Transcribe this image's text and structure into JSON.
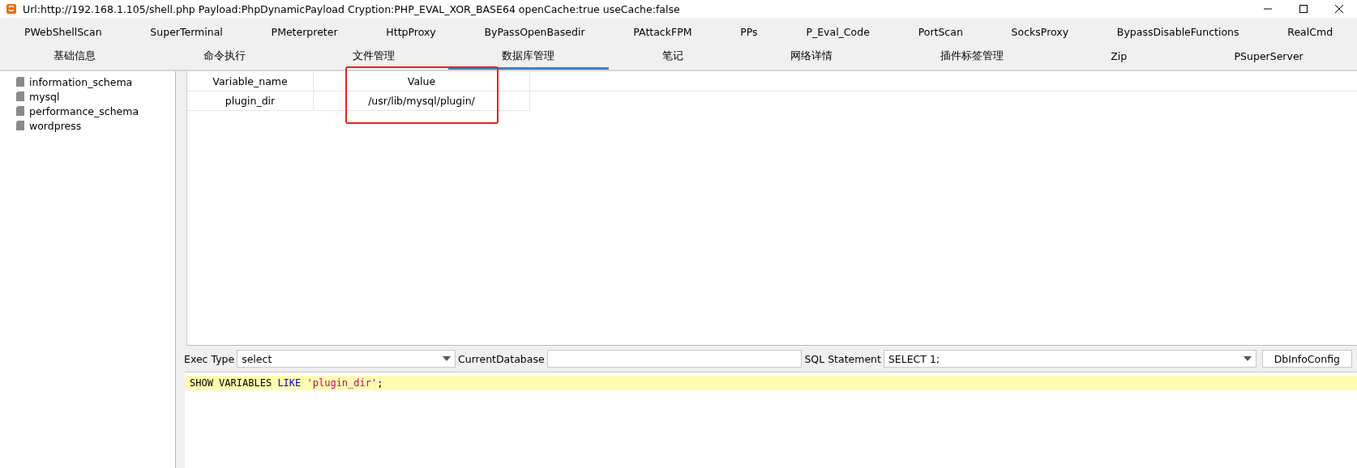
{
  "window": {
    "title": "Url:http://192.168.1.105/shell.php Payload:PhpDynamicPayload Cryption:PHP_EVAL_XOR_BASE64 openCache:true useCache:false"
  },
  "tab_rows": [
    [
      {
        "label": "PWebShellScan",
        "selected": false
      },
      {
        "label": "SuperTerminal",
        "selected": false
      },
      {
        "label": "PMeterpreter",
        "selected": false
      },
      {
        "label": "HttpProxy",
        "selected": false
      },
      {
        "label": "ByPassOpenBasedir",
        "selected": false
      },
      {
        "label": "PAttackFPM",
        "selected": false
      },
      {
        "label": "PPs",
        "selected": false
      },
      {
        "label": "P_Eval_Code",
        "selected": false
      },
      {
        "label": "PortScan",
        "selected": false
      },
      {
        "label": "SocksProxy",
        "selected": false
      },
      {
        "label": "BypassDisableFunctions",
        "selected": false
      },
      {
        "label": "RealCmd",
        "selected": false
      }
    ],
    [
      {
        "label": "基础信息",
        "selected": false
      },
      {
        "label": "命令执行",
        "selected": false
      },
      {
        "label": "文件管理",
        "selected": false
      },
      {
        "label": "数据库管理",
        "selected": true
      },
      {
        "label": "笔记",
        "selected": false
      },
      {
        "label": "网络详情",
        "selected": false
      },
      {
        "label": "插件标签管理",
        "selected": false
      },
      {
        "label": "Zip",
        "selected": false
      },
      {
        "label": "PSuperServer",
        "selected": false
      }
    ]
  ],
  "databases": [
    "information_schema",
    "mysql",
    "performance_schema",
    "wordpress"
  ],
  "table": {
    "columns": [
      "Variable_name",
      "Value"
    ],
    "rows": [
      [
        "plugin_dir",
        "/usr/lib/mysql/plugin/"
      ]
    ]
  },
  "toolbar": {
    "exec_type_label": "Exec Type",
    "exec_type": "select",
    "current_db_label": "CurrentDatabase",
    "sql_label": "SQL Statement",
    "sql": "SELECT 1;",
    "config_button": "DbInfoConfig"
  },
  "editor": {
    "tokens": [
      {
        "text": "SHOW VARIABLES ",
        "kind": "plain"
      },
      {
        "text": "LIKE",
        "kind": "keyword"
      },
      {
        "text": " 'plugin_dir'",
        "kind": "string"
      },
      {
        "text": ";",
        "kind": "plain"
      }
    ]
  }
}
